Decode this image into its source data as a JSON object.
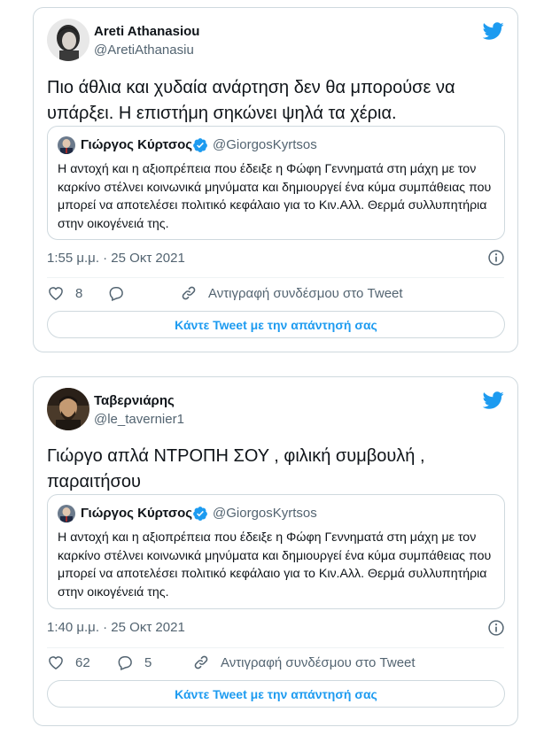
{
  "colors": {
    "accent": "#1d9bf0",
    "text": "#0f1419",
    "muted": "#536471",
    "border": "#cfd9de"
  },
  "tweets": [
    {
      "author_name": "Areti Athanasiou",
      "author_handle": "@AretiAthanasiu",
      "text": "Πιο άθλια και χυδαία ανάρτηση  δεν θα μπορούσε να υπάρξει. Η επιστήμη σηκώνει ψηλά τα χέρια.",
      "quoted": {
        "author_name": "Γιώργος Κύρτσος",
        "author_handle": "@GiorgosKyrtsos",
        "verified_icon": "verified-badge-icon",
        "text": "Η αντοχή και η αξιοπρέπεια που έδειξε η Φώφη Γεννηματά στη μάχη με τον καρκίνο στέλνει κοινωνικά μηνύματα και δημιουργεί ένα κύμα συμπάθειας που μπορεί να αποτελέσει πολιτικό κεφάλαιο για το Κιν.Αλλ. Θερμά συλλυπητήρια στην οικογένειά της."
      },
      "timestamp": "1:55 μ.μ. · 25 Οκτ 2021",
      "likes": "8",
      "replies": "",
      "copy_link_label": "Αντιγραφή συνδέσμου στο Tweet",
      "reply_button_label": "Κάντε Tweet με την απάντησή σας"
    },
    {
      "author_name": "Ταβερνιάρης",
      "author_handle": "@le_tavernier1",
      "text": "Γιώργο απλά ΝΤΡΟΠΗ ΣΟΥ , φιλική συμβουλή , παραιτήσου",
      "quoted": {
        "author_name": "Γιώργος Κύρτσος",
        "author_handle": "@GiorgosKyrtsos",
        "verified_icon": "verified-badge-icon",
        "text": "Η αντοχή και η αξιοπρέπεια που έδειξε η Φώφη Γεννηματά στη μάχη με τον καρκίνο στέλνει κοινωνικά μηνύματα και δημιουργεί ένα κύμα συμπάθειας που μπορεί να αποτελέσει πολιτικό κεφάλαιο για το Κιν.Αλλ. Θερμά συλλυπητήρια στην οικογένειά της."
      },
      "timestamp": "1:40 μ.μ. · 25 Οκτ 2021",
      "likes": "62",
      "replies": "5",
      "copy_link_label": "Αντιγραφή συνδέσμου στο Tweet",
      "reply_button_label": "Κάντε Tweet με την απάντησή σας"
    }
  ],
  "icons": {
    "logo": "twitter-bird-icon",
    "info": "info-icon",
    "like": "heart-icon",
    "reply": "reply-bubble-icon",
    "link": "link-icon"
  }
}
